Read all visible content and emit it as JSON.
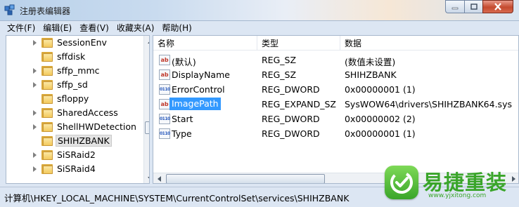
{
  "window": {
    "title": "注册表编辑器",
    "icon": "regedit-icon"
  },
  "menu": [
    "文件(F)",
    "编辑(E)",
    "查看(V)",
    "收藏夹(A)",
    "帮助(H)"
  ],
  "tree": {
    "items": [
      {
        "label": "SessionEnv",
        "selected": false
      },
      {
        "label": "sffdisk",
        "selected": false
      },
      {
        "label": "sffp_mmc",
        "selected": false
      },
      {
        "label": "sffp_sd",
        "selected": false
      },
      {
        "label": "sfloppy",
        "selected": false
      },
      {
        "label": "SharedAccess",
        "selected": false
      },
      {
        "label": "ShellHWDetection",
        "selected": false
      },
      {
        "label": "SHIHZBANK",
        "selected": true
      },
      {
        "label": "SiSRaid2",
        "selected": false
      },
      {
        "label": "SiSRaid4",
        "selected": false
      }
    ]
  },
  "values": {
    "columns": {
      "name": "名称",
      "type": "类型",
      "data": "数据"
    },
    "rows": [
      {
        "icon": "string-value-icon",
        "name": "(默认)",
        "type": "REG_SZ",
        "data": "(数值未设置)",
        "selected": false
      },
      {
        "icon": "string-value-icon",
        "name": "DisplayName",
        "type": "REG_SZ",
        "data": "SHIHZBANK",
        "selected": false
      },
      {
        "icon": "binary-value-icon",
        "name": "ErrorControl",
        "type": "REG_DWORD",
        "data": "0x00000001 (1)",
        "selected": false
      },
      {
        "icon": "string-value-icon",
        "name": "ImagePath",
        "type": "REG_EXPAND_SZ",
        "data": "SysWOW64\\drivers\\SHIHZBANK64.sys",
        "selected": true
      },
      {
        "icon": "binary-value-icon",
        "name": "Start",
        "type": "REG_DWORD",
        "data": "0x00000002 (2)",
        "selected": false
      },
      {
        "icon": "binary-value-icon",
        "name": "Type",
        "type": "REG_DWORD",
        "data": "0x00000001 (1)",
        "selected": false
      }
    ]
  },
  "status": {
    "path": "计算机\\HKEY_LOCAL_MACHINE\\SYSTEM\\CurrentControlSet\\services\\SHIHZBANK"
  },
  "watermark": {
    "text": "易捷重装",
    "url": "www.yjxitong.com"
  },
  "colors": {
    "selection": "#3399ff",
    "watermark_green": "#3aa52a"
  }
}
